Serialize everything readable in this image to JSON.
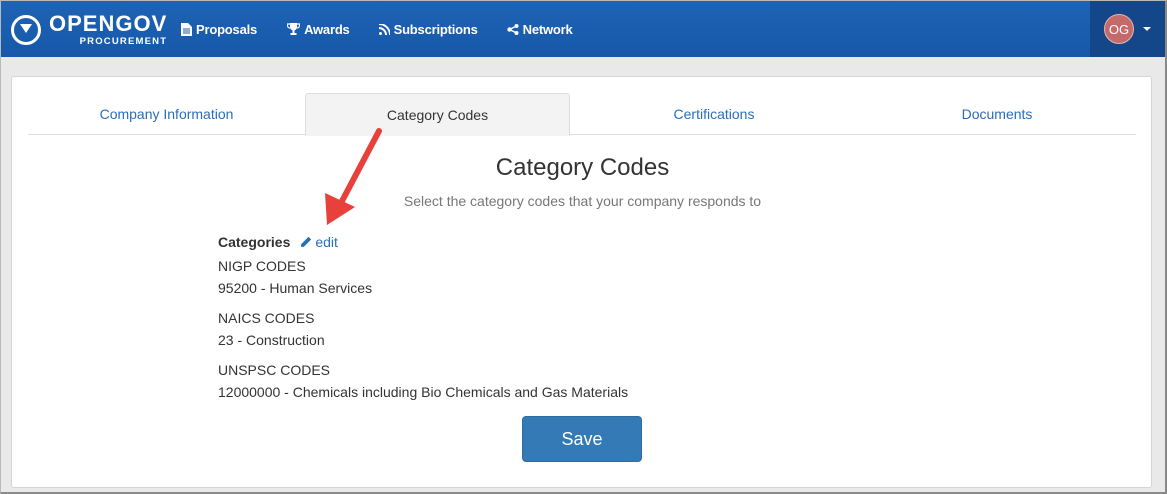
{
  "navbar": {
    "brand_name": "OPENGOV",
    "brand_sub": "PROCUREMENT",
    "items": [
      {
        "label": "Proposals",
        "icon": "file-icon"
      },
      {
        "label": "Awards",
        "icon": "trophy-icon"
      },
      {
        "label": "Subscriptions",
        "icon": "rss-icon"
      },
      {
        "label": "Network",
        "icon": "share-icon"
      }
    ],
    "user_initials": "OG",
    "color": "#1a5fb4"
  },
  "tabs": [
    {
      "label": "Company Information",
      "active": false
    },
    {
      "label": "Category Codes",
      "active": true
    },
    {
      "label": "Certifications",
      "active": false
    },
    {
      "label": "Documents",
      "active": false
    }
  ],
  "main": {
    "title": "Category Codes",
    "subtitle": "Select the category codes that your company responds to",
    "categories_label": "Categories",
    "edit_label": "edit",
    "groups": [
      {
        "heading": "NIGP CODES",
        "items": [
          "95200 - Human Services"
        ]
      },
      {
        "heading": "NAICS CODES",
        "items": [
          "23 - Construction"
        ]
      },
      {
        "heading": "UNSPSC CODES",
        "items": [
          "12000000 - Chemicals including Bio Chemicals and Gas Materials"
        ]
      }
    ],
    "save_label": "Save"
  },
  "annotation": {
    "type": "arrow",
    "color": "#e8403a",
    "points_to": "edit"
  }
}
